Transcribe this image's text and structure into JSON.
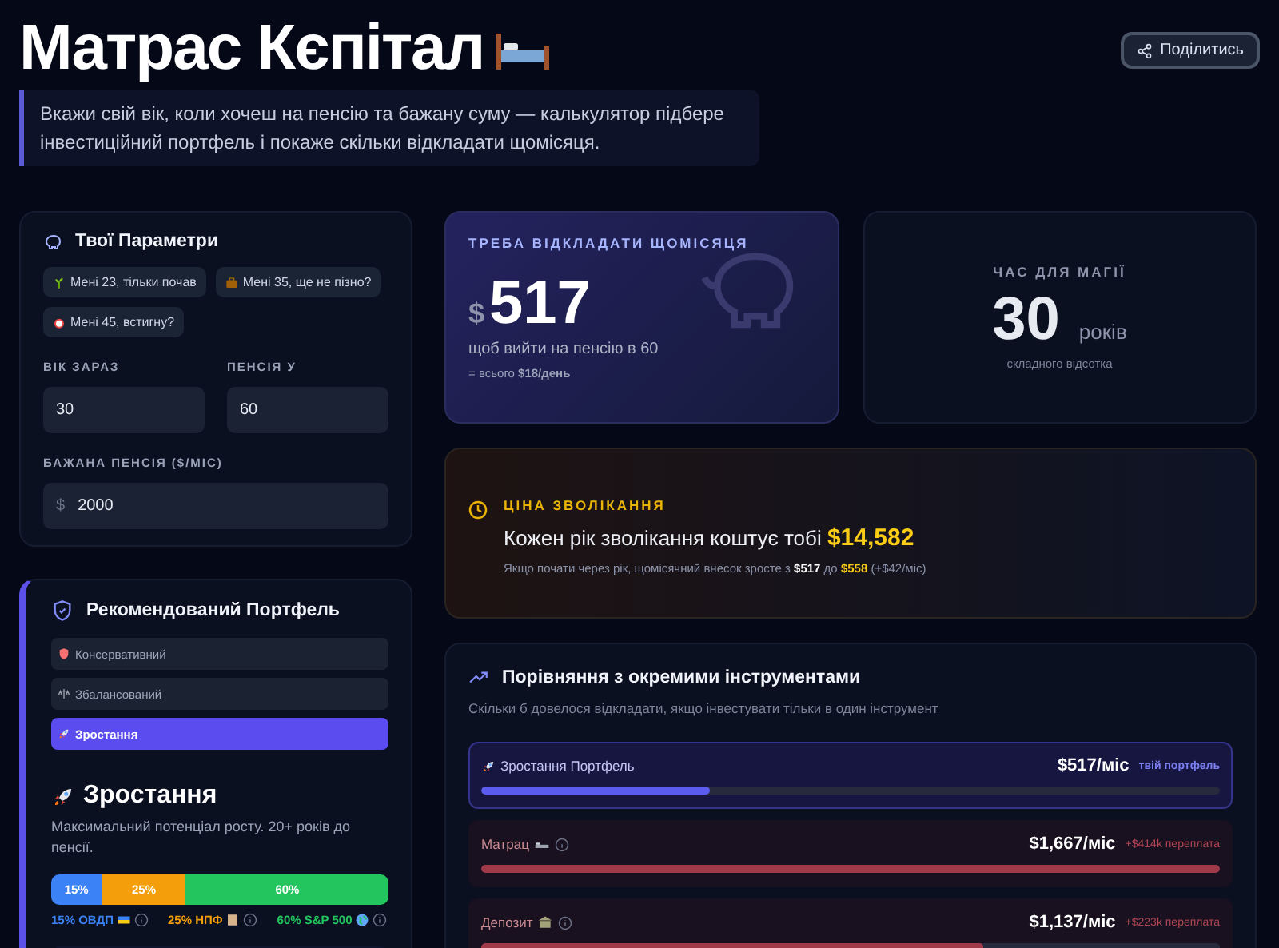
{
  "header": {
    "title": "Матрас Кєпітал",
    "share_button": "Поділитись",
    "description": "Вкажи свій вік, коли хочеш на пенсію та бажану суму — калькулятор підбере інвестиційний портфель і покаже скільки відкладати щомісяця."
  },
  "parameters": {
    "title": "Твої Параметри",
    "presets": [
      {
        "label": "Мені 23, тільки почав"
      },
      {
        "label": "Мені 35, ще не пізно?"
      },
      {
        "label": "Мені 45, встигну?"
      }
    ],
    "age_now": {
      "label": "ВІК ЗАРАЗ",
      "value": "30"
    },
    "retire_at": {
      "label": "ПЕНСІЯ У",
      "value": "60"
    },
    "desired_pension": {
      "label": "БАЖАНА ПЕНСІЯ ($/МІС)",
      "currency": "$",
      "value": "2000"
    }
  },
  "portfolio": {
    "title": "Рекомендований Портфель",
    "options": [
      {
        "label": "Консервативний",
        "selected": false
      },
      {
        "label": "Збалансований",
        "selected": false
      },
      {
        "label": "Зростання",
        "selected": true
      }
    ],
    "name": "Зростання",
    "description": "Максимальний потенціал росту. 20+ років до пенсії.",
    "allocation": [
      {
        "label": "15%",
        "color": "#3b82f6",
        "legend": "15% ОВДП"
      },
      {
        "label": "25%",
        "color": "#f59e0b",
        "legend": "25% НПФ"
      },
      {
        "label": "60%",
        "color": "#22c55e",
        "legend": "60% S&P 500"
      }
    ]
  },
  "monthly": {
    "label": "ТРЕБА ВІДКЛАДАТИ ЩОМІСЯЦЯ",
    "currency": "$",
    "amount": "517",
    "subtitle": "щоб вийти на пенсію в 60",
    "daily": "= всього **$18/день**"
  },
  "magic": {
    "label": "ЧАС ДЛЯ МАГІЇ",
    "years": "30",
    "unit": "років",
    "caption": "складного відсотка"
  },
  "delay": {
    "label": "ЦІНА ЗВОЛІКАННЯ",
    "headline": "Кожен рік зволікання коштує тобі **$14,582**",
    "detail": "Якщо почати через рік, щомісячний внесок зросте з **$517** до **$558** (+$42/міс)"
  },
  "comparison": {
    "title": "Порівняння з окремими інструментами",
    "subtitle": "Скільки б довелося відкладати, якщо інвестувати тільки в один інструмент",
    "rows": [
      {
        "kind": "portfolio",
        "name": "Зростання Портфель",
        "amount": "$517/міс",
        "note": "твій портфель",
        "level": 0.31
      },
      {
        "kind": "alternative",
        "name": "Матрац",
        "amount": "$1,667/міс",
        "note": "+$414k переплата",
        "level": 1
      },
      {
        "kind": "alternative",
        "name": "Депозит",
        "amount": "$1,137/міс",
        "note": "+$223k переплата",
        "level": 0.68
      }
    ]
  }
}
